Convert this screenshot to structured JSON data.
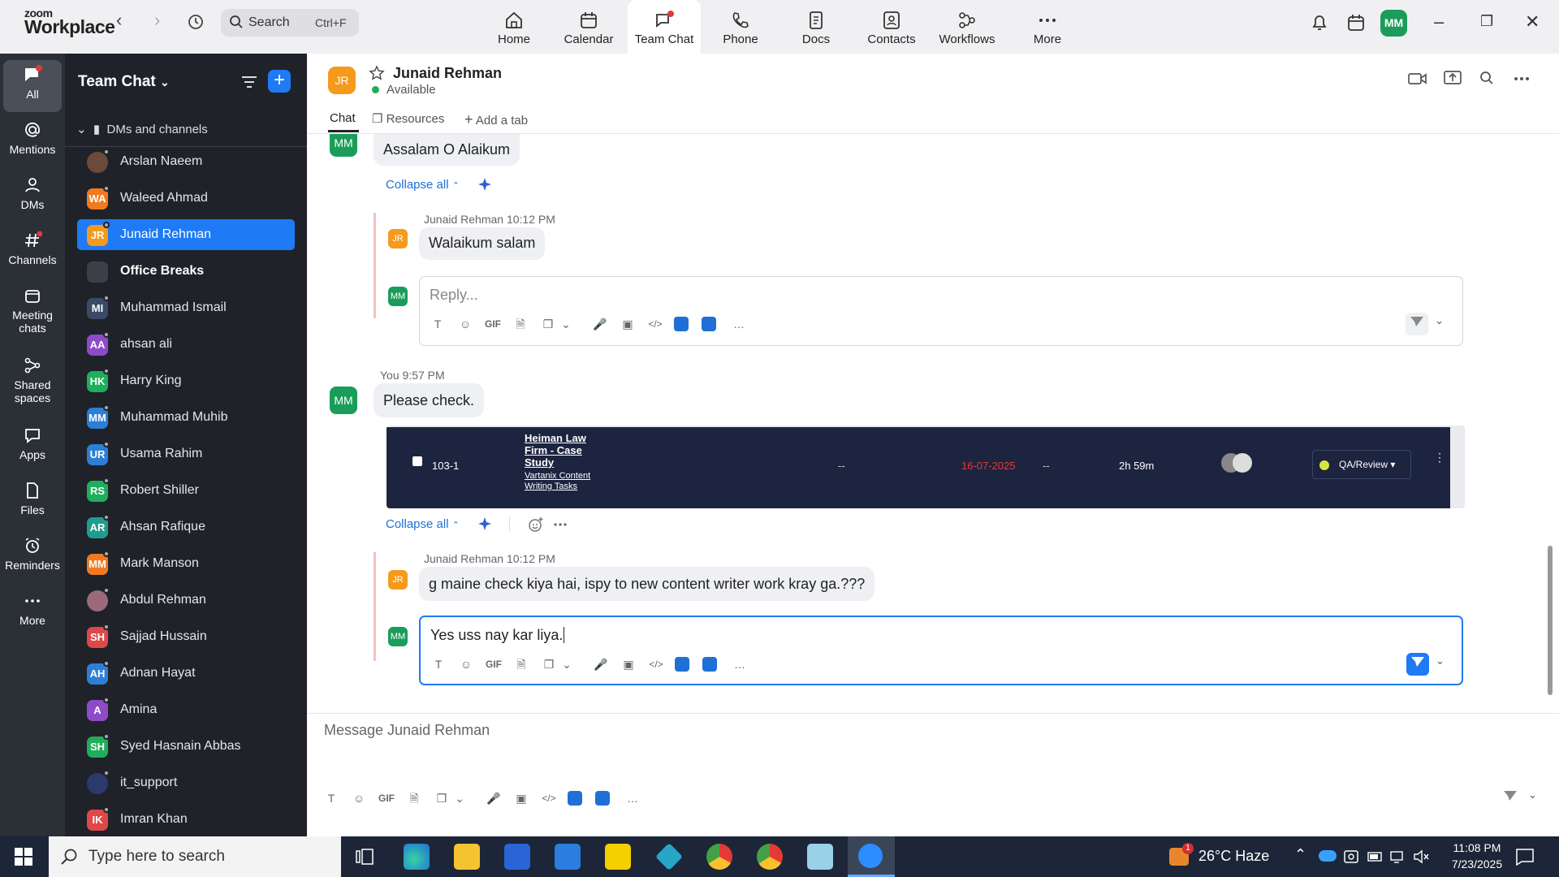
{
  "app": {
    "brand_small": "zoom",
    "brand_big": "Workplace"
  },
  "search": {
    "placeholder": "Search",
    "shortcut": "Ctrl+F"
  },
  "topnav": [
    {
      "label": "Home",
      "icon": "home-icon"
    },
    {
      "label": "Calendar",
      "icon": "calendar-icon"
    },
    {
      "label": "Team Chat",
      "icon": "chat-icon",
      "active": true
    },
    {
      "label": "Phone",
      "icon": "phone-icon"
    },
    {
      "label": "Docs",
      "icon": "docs-icon"
    },
    {
      "label": "Contacts",
      "icon": "contacts-icon"
    },
    {
      "label": "Workflows",
      "icon": "workflows-icon"
    },
    {
      "label": "More",
      "icon": "more-icon"
    }
  ],
  "user": {
    "initials": "MM"
  },
  "rail": [
    {
      "label": "All",
      "icon": "chat-bubble-icon"
    },
    {
      "label": "Mentions",
      "icon": "at-icon"
    },
    {
      "label": "DMs",
      "icon": "people-icon"
    },
    {
      "label": "Channels",
      "icon": "hash-icon"
    },
    {
      "label": "Meeting chats",
      "icon": "calendar-icon"
    },
    {
      "label": "Shared spaces",
      "icon": "share-icon"
    },
    {
      "label": "Apps",
      "icon": "apps-icon"
    },
    {
      "label": "Files",
      "icon": "file-icon"
    },
    {
      "label": "Reminders",
      "icon": "alarm-icon"
    },
    {
      "label": "More",
      "icon": "ellipsis-icon"
    }
  ],
  "channel_list": {
    "title": "Team Chat",
    "section": "DMs and channels",
    "items": [
      {
        "name": "Arslan Naeem",
        "initials": "",
        "color": "#6b4a3a"
      },
      {
        "name": "Waleed Ahmad",
        "initials": "WA",
        "color": "#f07a22"
      },
      {
        "name": "Junaid Rehman",
        "initials": "JR",
        "color": "#f59a1c",
        "selected": true
      },
      {
        "name": "Office Breaks",
        "initials": "",
        "color": "#3b3f47",
        "bold": true
      },
      {
        "name": "Muhammad Ismail",
        "initials": "MI",
        "color": "#3b4a66"
      },
      {
        "name": "ahsan ali",
        "initials": "AA",
        "color": "#8e4bc7"
      },
      {
        "name": "Harry King",
        "initials": "HK",
        "color": "#1fae5b"
      },
      {
        "name": "Muhammad Muhib",
        "initials": "MM",
        "color": "#2d7fd6"
      },
      {
        "name": "Usama Rahim",
        "initials": "UR",
        "color": "#2d7fd6"
      },
      {
        "name": "Robert Shiller",
        "initials": "RS",
        "color": "#1fae5b"
      },
      {
        "name": "Ahsan Rafique",
        "initials": "AR",
        "color": "#1f9c8e"
      },
      {
        "name": "Mark Manson",
        "initials": "MM",
        "color": "#f07a22"
      },
      {
        "name": "Abdul Rehman",
        "initials": "",
        "color": "#9a6a7a"
      },
      {
        "name": "Sajjad Hussain",
        "initials": "SH",
        "color": "#e04848"
      },
      {
        "name": "Adnan Hayat",
        "initials": "AH",
        "color": "#2d7fd6"
      },
      {
        "name": "Amina",
        "initials": "A",
        "color": "#8e4bc7"
      },
      {
        "name": "Syed Hasnain Abbas",
        "initials": "SH",
        "color": "#1fae5b"
      },
      {
        "name": "it_support",
        "initials": "",
        "color": "#2b3a6b"
      },
      {
        "name": "Imran Khan",
        "initials": "IK",
        "color": "#e04848"
      }
    ]
  },
  "chat": {
    "contact_name": "Junaid Rehman",
    "contact_initials": "JR",
    "status": "Available",
    "tabs": [
      "Chat",
      "Resources",
      "Add a tab"
    ],
    "msg1": "Assalam O Alaikum",
    "collapse_label": "Collapse all",
    "reply1": {
      "author": "Junaid Rehman",
      "time": "10:12 PM",
      "text": "Walaikum salam"
    },
    "reply_placeholder": "Reply...",
    "msg2_meta": {
      "author": "You",
      "time": "9:57 PM"
    },
    "msg2": "Please check.",
    "screenshot": {
      "id": "103-1",
      "title": "Heiman Law Firm - Case Study",
      "subtitle": "Vartanix Content Writing Tasks",
      "dash1": "--",
      "date": "16-07-2025",
      "dash2": "--",
      "duration": "2h 59m",
      "status": "QA/Review"
    },
    "reply2": {
      "author": "Junaid Rehman",
      "time": "10:12 PM",
      "text": "g maine check kiya hai, ispy to new content writer work kray ga.???"
    },
    "draft": "Yes uss nay kar liya.",
    "composer_placeholder": "Message Junaid Rehman",
    "toolbar": {
      "gif": "GIF"
    }
  },
  "taskbar": {
    "search_placeholder": "Type here to search",
    "weather": "26°C  Haze",
    "weather_badge": "1",
    "time": "11:08 PM",
    "date": "7/23/2025"
  },
  "colors": {
    "accent": "#1f7af5",
    "rail_bg": "#2b2f36",
    "list_bg": "#1f2329",
    "date_red": "#e53935"
  }
}
